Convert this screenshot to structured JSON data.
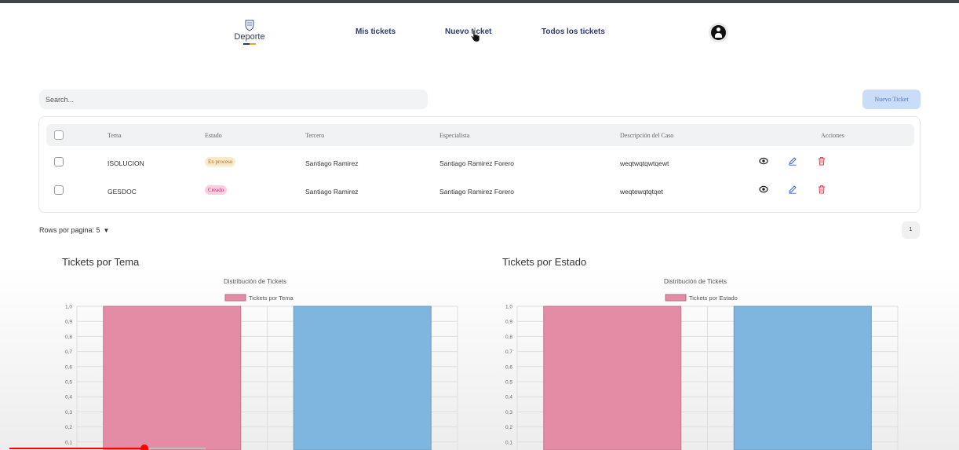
{
  "nav": {
    "brand": "Deporte",
    "links": [
      "Mis tickets",
      "Nuevo ticket",
      "Todos los tickets"
    ]
  },
  "search": {
    "placeholder": "Search..."
  },
  "toolbar": {
    "new_ticket_label": "Nuevo Ticket"
  },
  "table": {
    "headers": {
      "tema": "Tema",
      "estado": "Estado",
      "tercero": "Tercero",
      "especialista": "Especialista",
      "descripcion": "Descripción del Caso",
      "acciones": "Acciones"
    },
    "rows": [
      {
        "tema": "ISOLUCION",
        "estado": "En proceso",
        "tercero": "Santiago Ramirez",
        "especialista": "Santiago Ramirez Forero",
        "descripcion": "weqtwqtqwtqewt"
      },
      {
        "tema": "GESDOC",
        "estado": "Creado",
        "tercero": "Santiago Ramirez",
        "especialista": "Santiago Ramirez Forero",
        "descripcion": "weqtewqtqtqet"
      }
    ]
  },
  "pagination": {
    "rows_label": "Rows por pagina: 5",
    "page": "1"
  },
  "colors": {
    "nav_text": "#2e3a6e",
    "badge_en_proceso_bg": "#fbe9c9",
    "badge_creado_bg": "#f9cfe0",
    "new_ticket_bg": "#c9dcf8",
    "action_edit": "#3b63d6",
    "action_delete": "#e03a4a",
    "bar_pink": "#e48ba6",
    "bar_blue": "#7fb6df"
  },
  "icons": {
    "nav": [
      "crest-logo-icon",
      "user-avatar-icon"
    ],
    "actions": [
      "eye-icon",
      "pencil-icon",
      "trash-icon"
    ]
  },
  "charts": {
    "tema": {
      "heading": "Tickets por Tema"
    },
    "estado": {
      "heading": "Tickets por Estado"
    }
  },
  "chart_data": [
    {
      "type": "bar",
      "title": "Distribución de Tickets",
      "series": [
        {
          "name": "Tickets por Tema",
          "values": [
            1,
            1
          ]
        }
      ],
      "bar_colors": [
        "#e48ba6",
        "#7fb6df"
      ],
      "ylim": [
        0,
        1
      ],
      "yticks": [
        "0,1",
        "0,2",
        "0,3",
        "0,4",
        "0,5",
        "0,6",
        "0,7",
        "0,8",
        "0,9",
        "1,0"
      ],
      "grid": true,
      "legend": "top-center"
    },
    {
      "type": "bar",
      "title": "Distribución de Tickets",
      "series": [
        {
          "name": "Tickets por Estado",
          "values": [
            1,
            1
          ]
        }
      ],
      "bar_colors": [
        "#e48ba6",
        "#7fb6df"
      ],
      "ylim": [
        0,
        1
      ],
      "yticks": [
        "0,1",
        "0,2",
        "0,3",
        "0,4",
        "0,5",
        "0,6",
        "0,7",
        "0,8",
        "0,9",
        "1,0"
      ],
      "grid": true,
      "legend": "top-center"
    }
  ]
}
